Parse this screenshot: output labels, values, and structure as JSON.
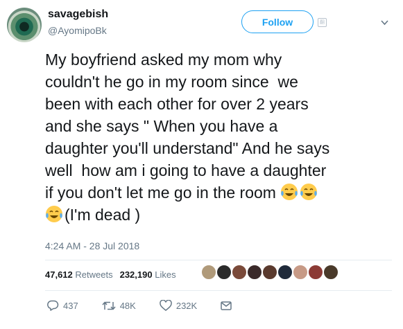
{
  "user": {
    "display_name": "savagebish",
    "handle": "@AyomipoBk"
  },
  "follow_label": "Follow",
  "tweet": {
    "line1": "My boyfriend asked my mom why",
    "line2": "couldn't he go in my room since  we",
    "line3": "been with each other for over 2 years",
    "line4": "and she says \" When you have a",
    "line5": "daughter you'll understand\" And he says",
    "line6": "well  how am i going to have a daughter",
    "line7": "if you don't let me go in the room ",
    "line8": "(I'm dead )"
  },
  "timestamp": "4:24 AM - 28 Jul 2018",
  "stats": {
    "retweets_count": "47,612",
    "retweets_label": "Retweets",
    "likes_count": "232,190",
    "likes_label": "Likes"
  },
  "actions": {
    "replies": "437",
    "retweets": "48K",
    "likes": "232K"
  },
  "colors": {
    "accent": "#1da1f2",
    "text": "#14171a",
    "muted": "#657786",
    "divider": "#e6ecf0",
    "emoji": "#ffcc4d"
  },
  "icons": [
    "chevron-down-icon",
    "translate-icon",
    "reply-icon",
    "retweet-icon",
    "like-icon",
    "direct-message-icon",
    "tears-of-joy-emoji"
  ]
}
